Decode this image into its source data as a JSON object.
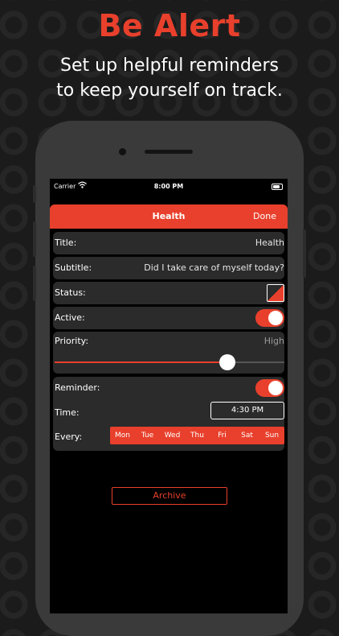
{
  "headline": "Be Alert",
  "subhead": {
    "line1": "Set up helpful reminders",
    "line2": "to keep yourself on track."
  },
  "statusbar": {
    "carrier": "Carrier",
    "time": "8:00 PM"
  },
  "navbar": {
    "title": "Health",
    "done_label": "Done"
  },
  "form": {
    "title": {
      "label": "Title:",
      "value": "Health"
    },
    "subtitle": {
      "label": "Subtitle:",
      "value": "Did I take care of myself today?"
    },
    "status": {
      "label": "Status:"
    },
    "active": {
      "label": "Active:",
      "on": true
    },
    "priority": {
      "label": "Priority:",
      "value": "High",
      "level": 0.75
    },
    "reminder": {
      "label": "Reminder:",
      "on": true
    },
    "time": {
      "label": "Time:",
      "value": "4:30 PM"
    },
    "every": {
      "label": "Every:",
      "days": [
        "Mon",
        "Tue",
        "Wed",
        "Thu",
        "Fri",
        "Sat",
        "Sun"
      ]
    }
  },
  "archive_label": "Archive",
  "colors": {
    "accent": "#e8402c",
    "background": "#1b1b1b",
    "card": "#2b2b2b"
  }
}
